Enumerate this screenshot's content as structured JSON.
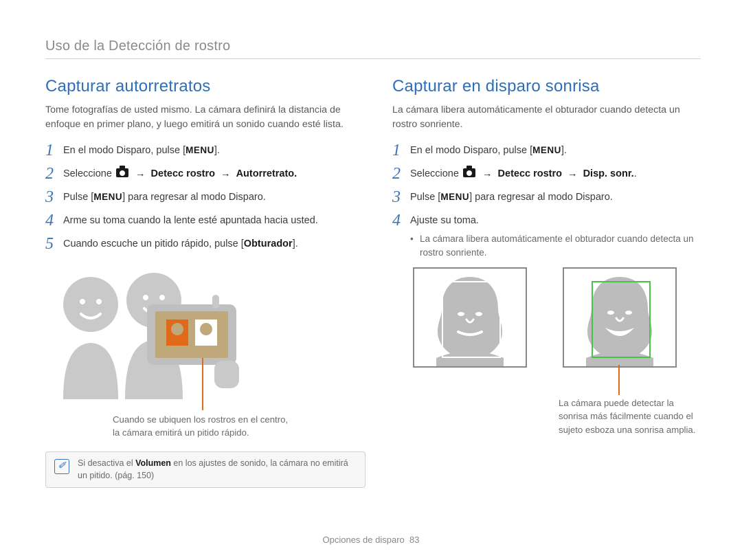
{
  "section_header": "Uso de la Detección de rostro",
  "footer": {
    "label": "Opciones de disparo",
    "page": "83"
  },
  "menu_label": "MENU",
  "left": {
    "title": "Capturar autorretratos",
    "intro": "Tome fotografías de usted mismo. La cámara definirá la distancia de enfoque en primer plano, y luego emitirá un sonido cuando esté lista.",
    "steps": {
      "s1_pre": "En el modo Disparo, pulse [",
      "s1_post": "].",
      "s2_pre": "Seleccione ",
      "s2_bold": "Detecc rostro",
      "s2_arrow": "→",
      "s2_bold2": "Autorretrato",
      "s3_pre": "Pulse [",
      "s3_post": "] para regresar al modo Disparo.",
      "s4": "Arme su toma cuando la lente esté apuntada hacia usted.",
      "s5_pre": "Cuando escuche un pitido rápido, pulse [",
      "s5_bold": "Obturador",
      "s5_post": "]."
    },
    "callout": "Cuando se ubiquen los rostros en el centro, la cámara emitirá un pitido rápido.",
    "note_pre": "Si desactiva el ",
    "note_bold": "Volumen",
    "note_post": " en los ajustes de sonido, la cámara no emitirá un pitido. (pág. 150)"
  },
  "right": {
    "title": "Capturar en disparo sonrisa",
    "intro": "La cámara libera automáticamente el obturador cuando detecta un rostro sonriente.",
    "steps": {
      "s1_pre": "En el modo Disparo, pulse [",
      "s1_post": "].",
      "s2_pre": "Seleccione ",
      "s2_bold": "Detecc rostro",
      "s2_arrow": "→",
      "s2_bold2": "Disp. sonr.",
      "s3_pre": "Pulse [",
      "s3_post": "] para regresar al modo Disparo.",
      "s4": "Ajuste su toma.",
      "s4_sub": "La cámara libera automáticamente el obturador cuando detecta un rostro sonriente."
    },
    "callout": "La cámara puede detectar la sonrisa más fácilmente cuando el sujeto esboza una sonrisa amplia."
  }
}
